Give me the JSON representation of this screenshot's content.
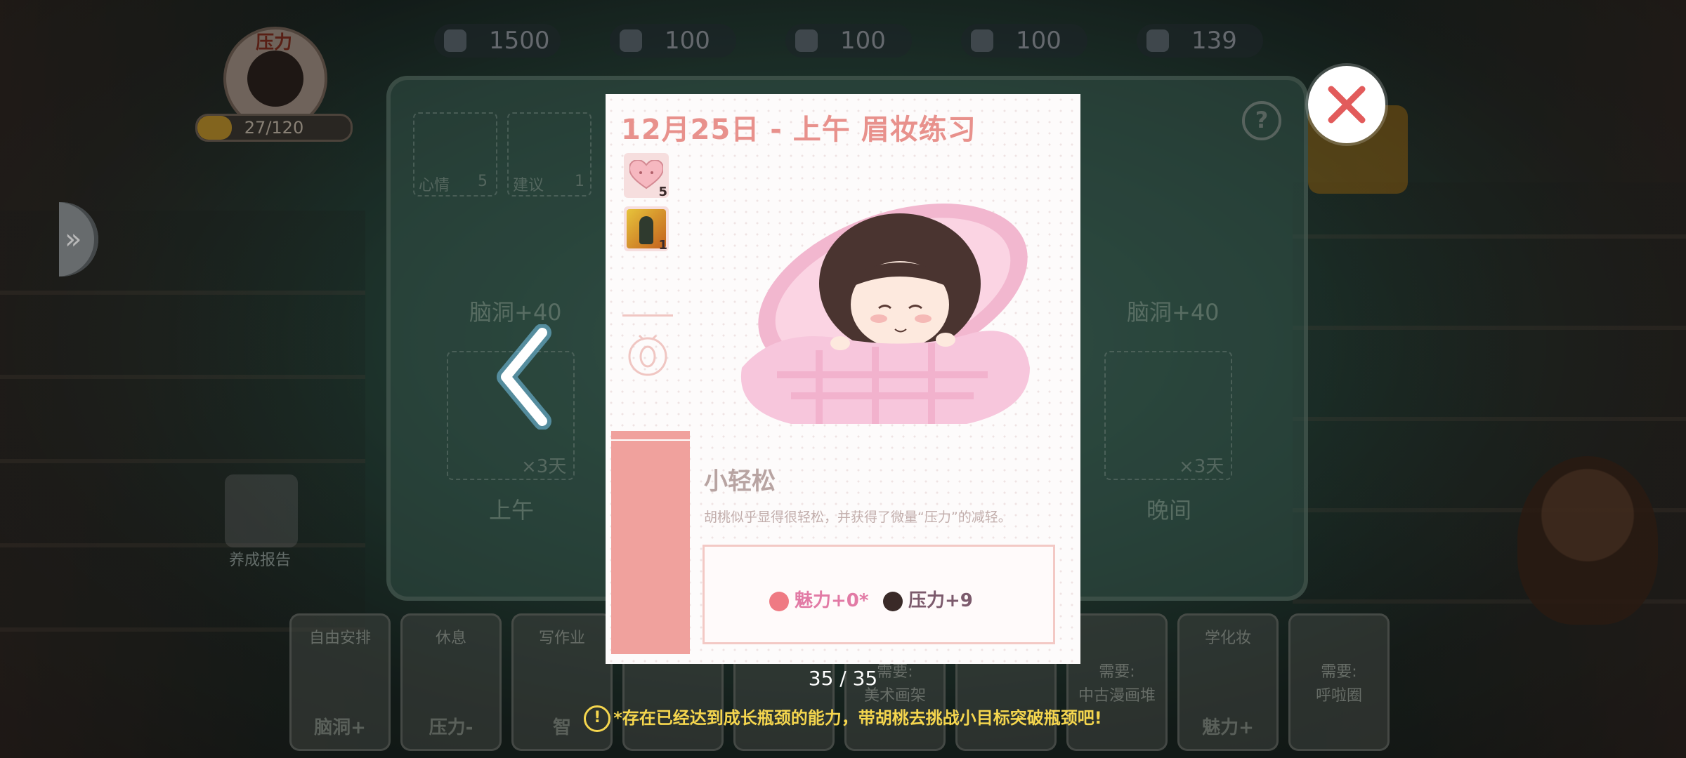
{
  "top_bar": {
    "pressure_label": "压力",
    "pressure_progress": "27/120",
    "pressure_fraction": 0.225,
    "stats": [
      {
        "icon": "graduation-cap-icon",
        "value": "1500"
      },
      {
        "icon": "foot-icon",
        "value": "100"
      },
      {
        "icon": "pencil-icon",
        "value": "100"
      },
      {
        "icon": "paw-icon",
        "value": "100"
      },
      {
        "icon": "hand-icon",
        "value": "139"
      }
    ]
  },
  "board": {
    "mood_label": "心情",
    "mood_count": "5",
    "suggest_label": "建议",
    "suggest_count": "1",
    "left_gain": "脑洞+40",
    "right_gain": "脑洞+40",
    "left_days": "×3天",
    "right_days": "×3天",
    "morning": "上午",
    "evening": "晚间",
    "report": "养成报告"
  },
  "tray": [
    {
      "title": "自由安排",
      "bottom": "脑洞+"
    },
    {
      "title": "休息",
      "bottom": "压力-"
    },
    {
      "title": "写作业",
      "bottom": "智"
    },
    {
      "title": "",
      "bottom": ""
    },
    {
      "title": "",
      "bottom": ""
    },
    {
      "title": "",
      "bottom": "",
      "mid1": "需要:",
      "mid2": "美术画架"
    },
    {
      "title": "",
      "bottom": ""
    },
    {
      "title": "",
      "bottom": "",
      "mid1": "需要:",
      "mid2": "中古漫画堆"
    },
    {
      "title": "学化妆",
      "bottom": "魅力+"
    },
    {
      "title": "",
      "bottom": "",
      "mid1": "需要:",
      "mid2": "呼啦圈"
    }
  ],
  "card": {
    "title": "12月25日 - 上午 眉妆练习",
    "mood_count": "5",
    "book_count": "1",
    "event_name": "小轻松",
    "event_desc": "胡桃似乎显得很轻松，并获得了微量“压力”的减轻。",
    "result_charm": "魅力+0*",
    "result_pressure": "压力+9"
  },
  "pager": "35 / 35",
  "tip": "*存在已经达到成长瓶颈的能力，带胡桃去挑战小目标突破瓶颈吧!",
  "colors": {
    "title_pink": "#e8918c",
    "accent_pink": "#f0a19d",
    "tip_yellow": "#f5d64e",
    "close_red": "#e25b5b"
  }
}
